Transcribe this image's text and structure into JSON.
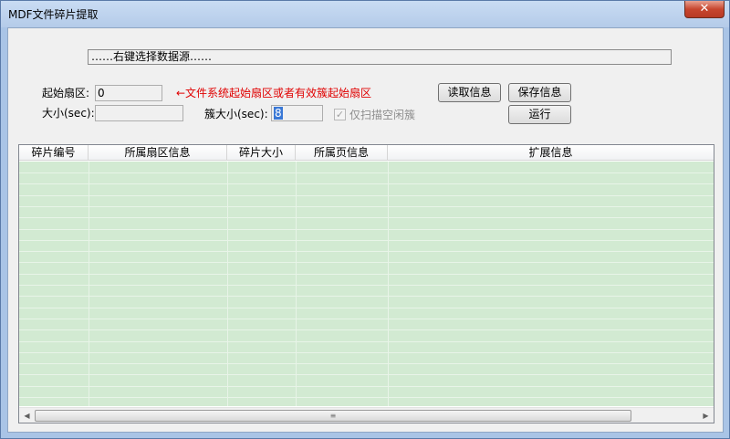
{
  "window": {
    "title": "MDF文件碎片提取",
    "close_glyph": "✕"
  },
  "source": {
    "text": "……右键选择数据源……"
  },
  "form": {
    "start_sector_label": "起始扇区:",
    "start_sector_value": "0",
    "start_sector_hint": "←文件系统起始扇区或者有效簇起始扇区",
    "size_label": "大小(sec):",
    "size_value": "",
    "cluster_label": "簇大小(sec):",
    "cluster_value": "8",
    "scan_free_label": "仅扫描空闲簇",
    "scan_free_checked": true
  },
  "buttons": {
    "read": "读取信息",
    "save": "保存信息",
    "run": "运行"
  },
  "table": {
    "columns": [
      "碎片编号",
      "所属扇区信息",
      "碎片大小",
      "所属页信息",
      "扩展信息"
    ],
    "rows": []
  },
  "scrollbar": {
    "left": "◀",
    "right": "▶",
    "grip": "≡"
  },
  "colors": {
    "grid_bg": "#d2ead2",
    "hint": "#e00000",
    "title_bg": "#b4cbe9"
  }
}
